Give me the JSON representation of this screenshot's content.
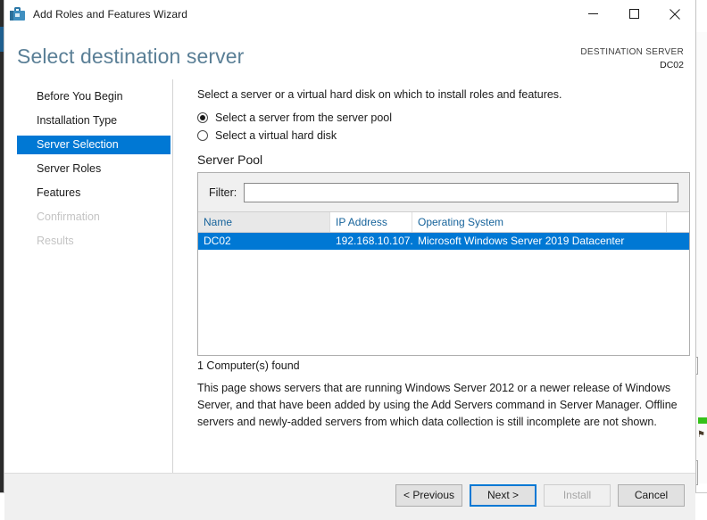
{
  "window": {
    "title": "Add Roles and Features Wizard",
    "icon": "toolbox-icon",
    "controls": {
      "minimize": "minimize-icon",
      "maximize": "maximize-icon",
      "close": "close-icon"
    }
  },
  "header": {
    "page_title": "Select destination server",
    "destination_label": "DESTINATION SERVER",
    "destination_value": "DC02"
  },
  "sidebar": {
    "items": [
      {
        "label": "Before You Begin",
        "state": "normal"
      },
      {
        "label": "Installation Type",
        "state": "normal"
      },
      {
        "label": "Server Selection",
        "state": "selected"
      },
      {
        "label": "Server Roles",
        "state": "normal"
      },
      {
        "label": "Features",
        "state": "normal"
      },
      {
        "label": "Confirmation",
        "state": "disabled"
      },
      {
        "label": "Results",
        "state": "disabled"
      }
    ]
  },
  "content": {
    "intro": "Select a server or a virtual hard disk on which to install roles and features.",
    "radios": [
      {
        "label": "Select a server from the server pool",
        "checked": true
      },
      {
        "label": "Select a virtual hard disk",
        "checked": false
      }
    ],
    "section_title": "Server Pool",
    "filter": {
      "label": "Filter:",
      "value": "",
      "placeholder": ""
    },
    "grid": {
      "columns": [
        "Name",
        "IP Address",
        "Operating System"
      ],
      "rows": [
        {
          "name": "DC02",
          "ip": "192.168.10.107...",
          "os": "Microsoft Windows Server 2019 Datacenter",
          "selected": true
        }
      ]
    },
    "found_text": "1 Computer(s) found",
    "note": "This page shows servers that are running Windows Server 2012 or a newer release of Windows Server, and that have been added by using the Add Servers command in Server Manager. Offline servers and newly-added servers from which data collection is still incomplete are not shown."
  },
  "footer": {
    "previous": "< Previous",
    "next": "Next >",
    "install": "Install",
    "cancel": "Cancel"
  },
  "colors": {
    "accent": "#0078d4",
    "heading": "#5a7f96",
    "column_header": "#16639b",
    "status_green": "#35c11a"
  },
  "background": {
    "right_glyph": "⚑"
  }
}
